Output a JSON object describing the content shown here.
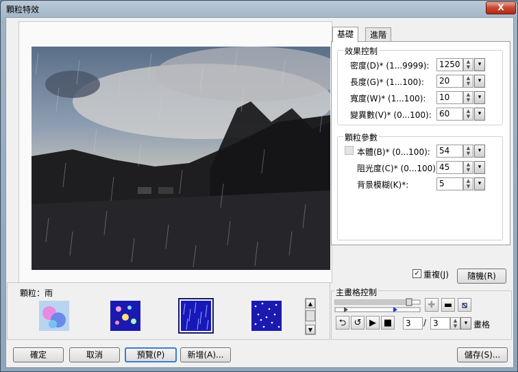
{
  "window": {
    "title": "顆粒特效",
    "close_glyph": "X"
  },
  "tabs": [
    {
      "label": "基礎"
    },
    {
      "label": "進階"
    }
  ],
  "effect_group": {
    "label": "效果控制",
    "rows": [
      {
        "label": "密度(D)* (1...9999):",
        "value": "1250"
      },
      {
        "label": "長度(G)* (1...100):",
        "value": "20"
      },
      {
        "label": "寬度(W)* (1...100):",
        "value": "10"
      },
      {
        "label": "變異數(V)* (0...100):",
        "value": "60"
      }
    ]
  },
  "particle_group": {
    "label": "顆粒參數",
    "rows": [
      {
        "label": "本體(B)* (0...100):",
        "value": "54"
      },
      {
        "label": "阻光度(C)* (0...100):",
        "value": "45"
      },
      {
        "label": "背景模糊(K)*:",
        "value": "5"
      }
    ]
  },
  "repeat": {
    "label": "重複(J)",
    "checked": true,
    "check_glyph": "✓"
  },
  "random_button": "隨機(R)",
  "particle_label": "顆粒：雨",
  "frame_control": {
    "label": "主畫格控制",
    "current": "3",
    "separator": "/",
    "total": "3",
    "unit": "畫格"
  },
  "buttons": {
    "ok": "確定",
    "cancel": "取消",
    "preview": "預覽(P)",
    "new": "新增(A)...",
    "save": "儲存(S)..."
  },
  "icons": {
    "plus": "✚",
    "minus": "▬",
    "play": "▶",
    "stop": "■",
    "loop": "⮌",
    "rewind": "↺"
  }
}
